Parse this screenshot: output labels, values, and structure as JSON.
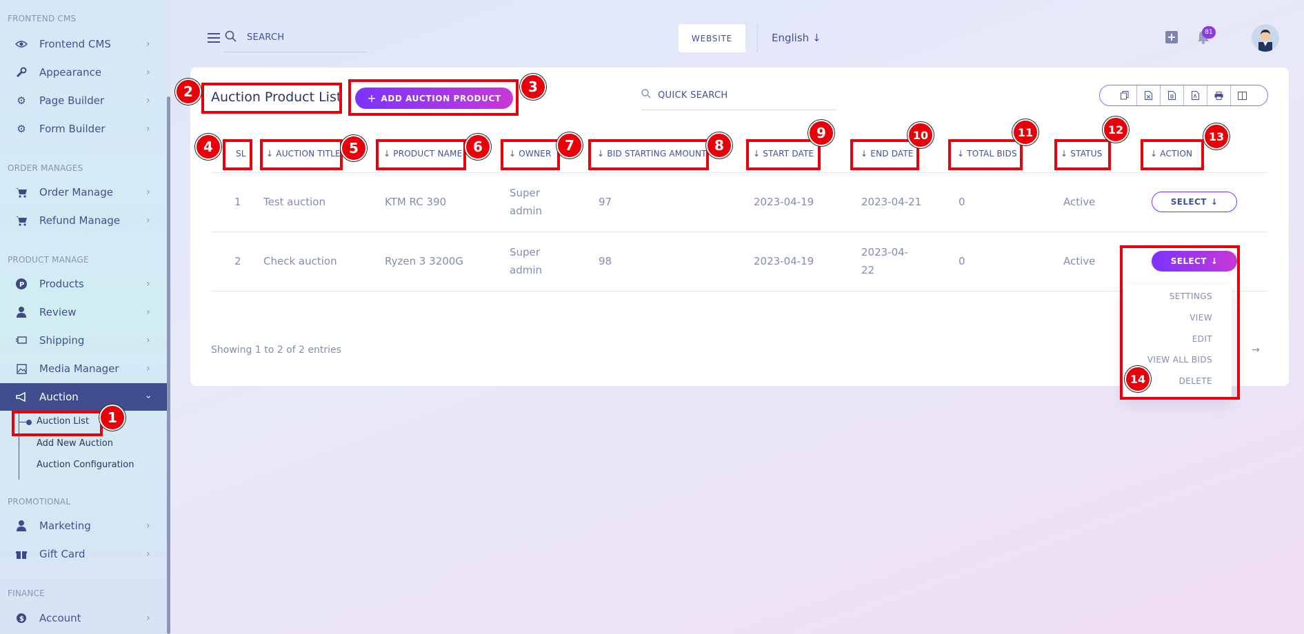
{
  "sidebar": {
    "sections": [
      {
        "title": "FRONTEND CMS"
      },
      {
        "title": "ORDER MANAGES"
      },
      {
        "title": "PRODUCT MANAGE"
      },
      {
        "title": "PROMOTIONAL"
      },
      {
        "title": "FINANCE"
      }
    ],
    "items": [
      {
        "label": "Frontend CMS",
        "icon": "eye-icon"
      },
      {
        "label": "Appearance",
        "icon": "wrench-icon"
      },
      {
        "label": "Page Builder",
        "icon": "gears-icon"
      },
      {
        "label": "Form Builder",
        "icon": "gears-icon"
      },
      {
        "label": "Order Manage",
        "icon": "cart-icon"
      },
      {
        "label": "Refund Manage",
        "icon": "cart-icon"
      },
      {
        "label": "Products",
        "icon": "product-icon"
      },
      {
        "label": "Review",
        "icon": "user-icon"
      },
      {
        "label": "Shipping",
        "icon": "shipping-icon"
      },
      {
        "label": "Media Manager",
        "icon": "image-icon"
      },
      {
        "label": "Auction",
        "icon": "megaphone-icon"
      },
      {
        "label": "Marketing",
        "icon": "user-icon"
      },
      {
        "label": "Gift Card",
        "icon": "gift-icon"
      },
      {
        "label": "Account",
        "icon": "account-icon"
      }
    ],
    "auction_sub": [
      "Auction List",
      "Add New Auction",
      "Auction Configuration"
    ]
  },
  "topbar": {
    "search_placeholder": "SEARCH",
    "website_label": "WEBSITE",
    "language": "English",
    "notification_count": "81"
  },
  "main": {
    "title": "Auction Product List",
    "add_button": "ADD AUCTION PRODUCT",
    "quick_search": "QUICK SEARCH",
    "toolbar_icons": [
      "copy-icon",
      "excel-icon",
      "csv-icon",
      "pdf-icon",
      "print-icon",
      "columns-icon"
    ],
    "columns": [
      "SL",
      "AUCTION TITLE",
      "PRODUCT NAME",
      "OWNER",
      "BID STARTING AMOUNT",
      "START DATE",
      "END DATE",
      "TOTAL BIDS",
      "STATUS",
      "ACTION"
    ],
    "rows": [
      {
        "sl": "1",
        "title": "Test auction",
        "product": "KTM RC 390",
        "owner_line1": "Super",
        "owner_line2": "admin",
        "bid": "97",
        "start": "2023-04-19",
        "end_line1": "2023-04-21",
        "end_line2": "",
        "bids": "0",
        "status": "Active",
        "action": "SELECT"
      },
      {
        "sl": "2",
        "title": "Check auction",
        "product": "Ryzen 3 3200G",
        "owner_line1": "Super",
        "owner_line2": "admin",
        "bid": "98",
        "start": "2023-04-19",
        "end_line1": "2023-04-",
        "end_line2": "22",
        "bids": "0",
        "status": "Active",
        "action": "SELECT"
      }
    ],
    "showing": "Showing 1 to 2 of 2 entries",
    "dropdown": [
      "SETTINGS",
      "VIEW",
      "EDIT",
      "VIEW ALL BIDS",
      "DELETE"
    ]
  },
  "annotations": [
    "1",
    "2",
    "3",
    "4",
    "5",
    "6",
    "7",
    "8",
    "9",
    "10",
    "11",
    "12",
    "13",
    "14"
  ],
  "colors": {
    "accent": "#7c32ff",
    "accent_end": "#c738d8",
    "sidebar_active": "#3f4d8f",
    "text_primary": "#415094",
    "annotation_red": "#e8000b"
  }
}
